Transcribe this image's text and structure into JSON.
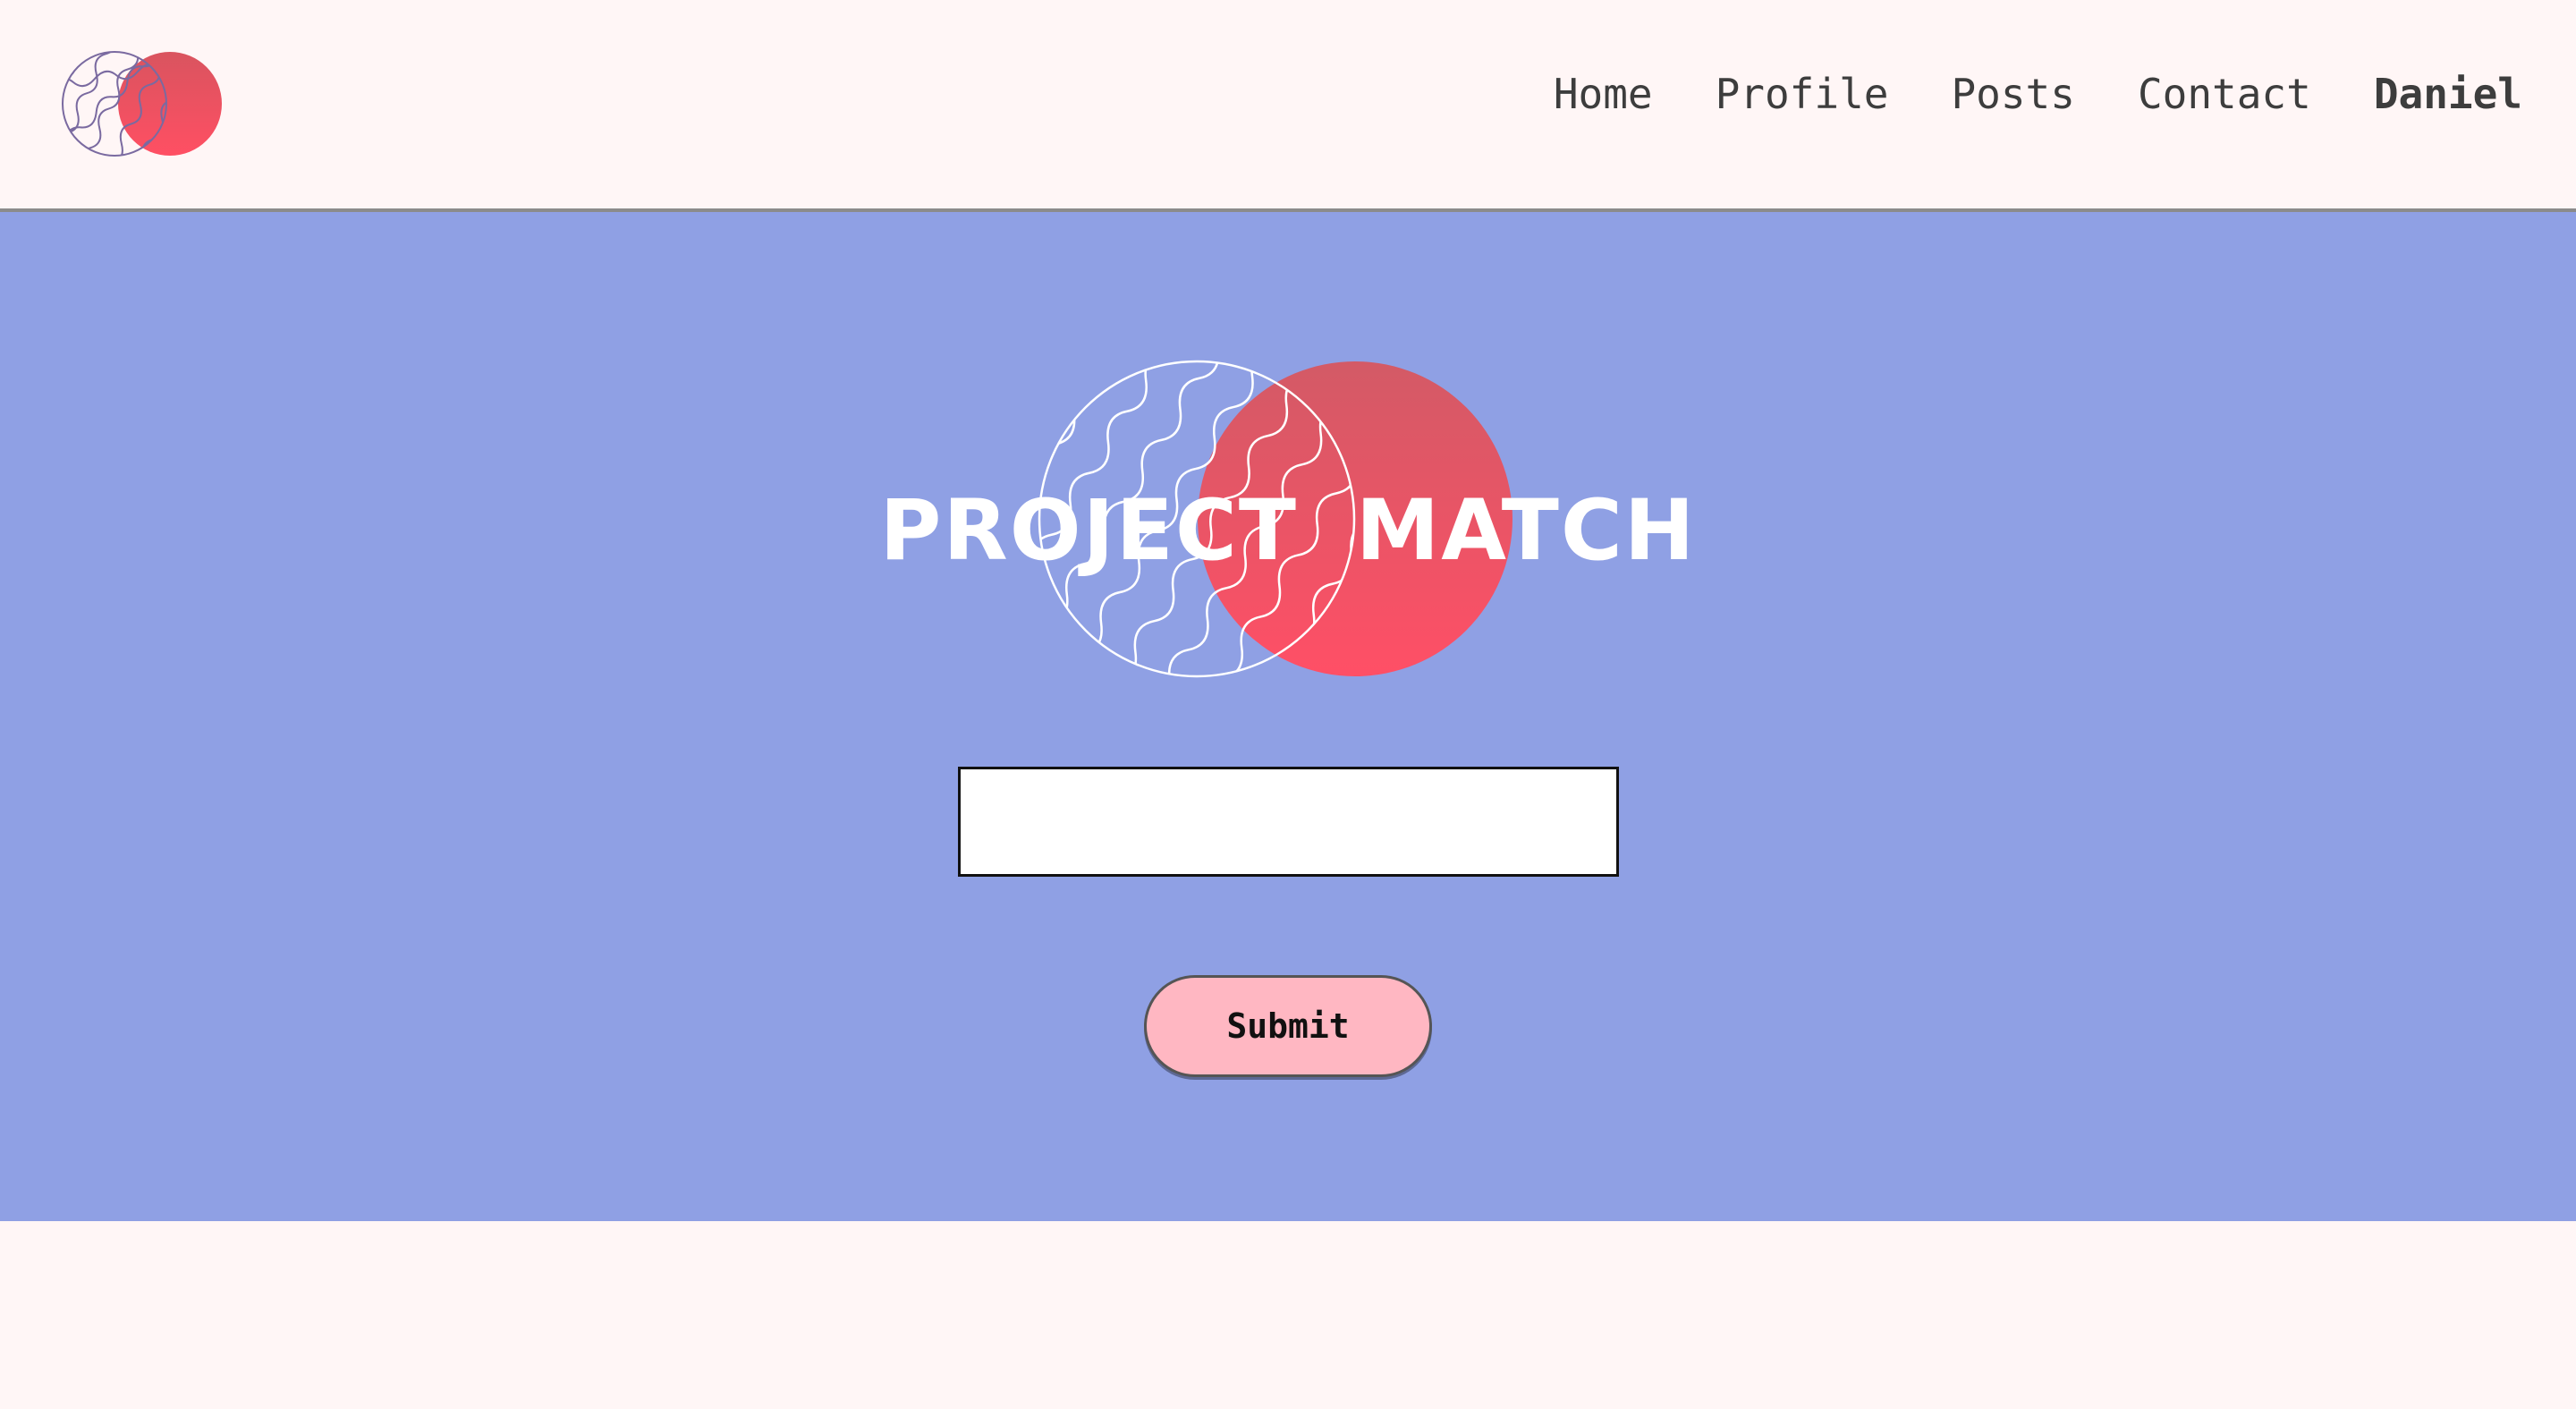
{
  "header": {
    "logo_icon": "project-match-logo",
    "nav": [
      {
        "label": "Home"
      },
      {
        "label": "Profile"
      },
      {
        "label": "Posts"
      },
      {
        "label": "Contact"
      }
    ],
    "user_name": "Daniel"
  },
  "hero": {
    "title": "PROJECT MATCH",
    "search_value": "",
    "search_placeholder": "",
    "submit_label": "Submit"
  },
  "colors": {
    "header_bg": "#fff6f6",
    "hero_bg": "#8fa0e4",
    "accent_red": "#ff5a6a",
    "button_bg": "#ffb7c2"
  }
}
